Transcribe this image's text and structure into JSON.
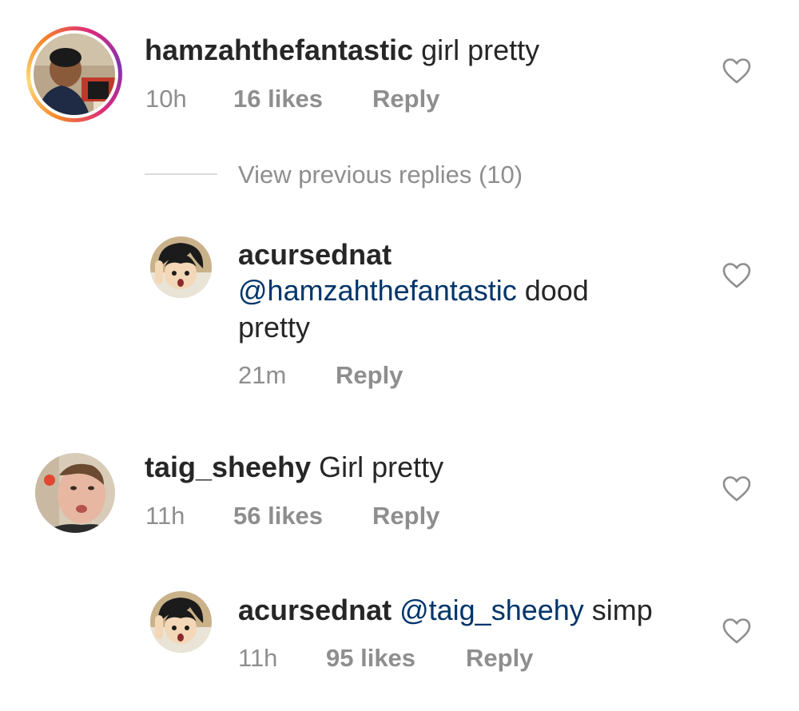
{
  "comments": [
    {
      "username": "hamzahthefantastic",
      "text": " girl pretty",
      "time": "10h",
      "likes": "16 likes",
      "reply": "Reply"
    },
    {
      "username": "taig_sheehy",
      "text": " Girl pretty",
      "time": "11h",
      "likes": "56 likes",
      "reply": "Reply"
    }
  ],
  "view_previous": "View previous replies (10)",
  "replies": [
    {
      "username": "acursednat",
      "mention": "@hamzahthefantastic",
      "text_line1_rest": " dood",
      "text_line2": "pretty",
      "time": "21m",
      "reply": "Reply"
    },
    {
      "username": "acursednat",
      "mention": "@taig_sheehy",
      "text": " simp",
      "time": "11h",
      "likes": "95 likes",
      "reply": "Reply"
    }
  ],
  "icons": {
    "like": "heart-outline-icon"
  },
  "colors": {
    "mention": "#003569",
    "meta": "#8e8e8e",
    "story_ring_start": "#f58529",
    "story_ring_end": "#dd2a7b"
  }
}
